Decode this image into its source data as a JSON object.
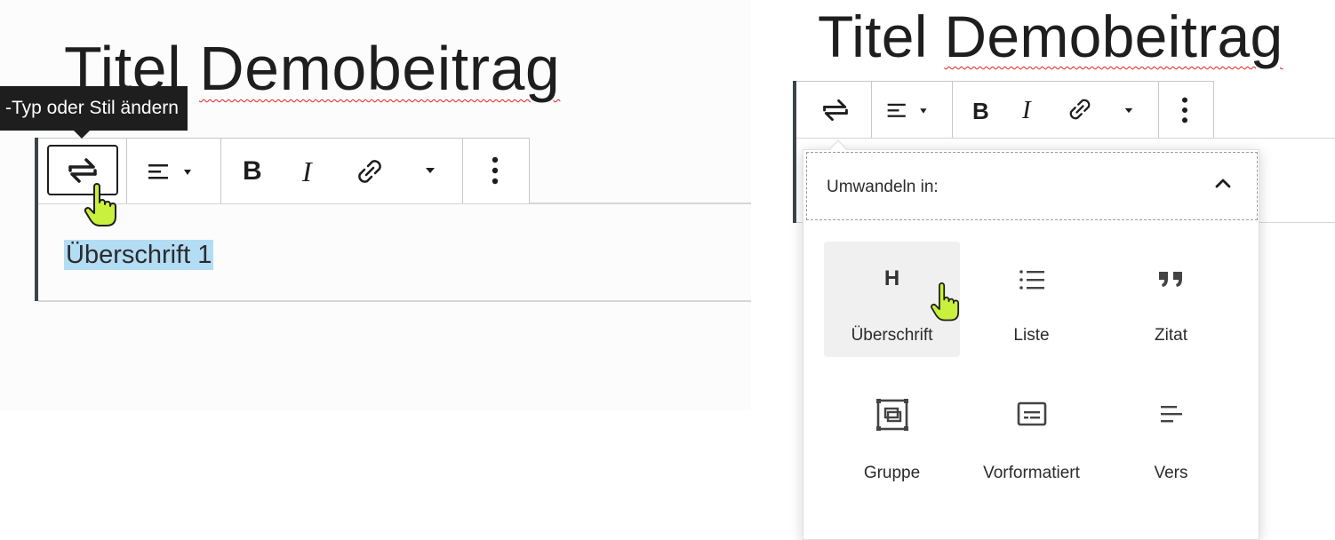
{
  "left": {
    "title_part1": "Titel",
    "title_part2": "Demobeitrag",
    "tooltip": "-Typ oder Stil ändern",
    "heading_text": "Überschrift 1"
  },
  "right": {
    "title_part1": "Titel",
    "title_part2": "Demobeitrag",
    "popover_title": "Umwandeln in:",
    "items": [
      {
        "label": "Überschrift",
        "icon": "heading-icon",
        "glyph": "H",
        "selected": true
      },
      {
        "label": "Liste",
        "icon": "list-icon"
      },
      {
        "label": "Zitat",
        "icon": "quote-icon"
      },
      {
        "label": "Gruppe",
        "icon": "group-icon"
      },
      {
        "label": "Vorformatiert",
        "icon": "preformatted-icon"
      },
      {
        "label": "Vers",
        "icon": "verse-icon"
      }
    ]
  },
  "toolbar": {
    "bold": "B",
    "italic": "I"
  },
  "colors": {
    "selection_highlight": "#b3dcf5",
    "cursor_hand": "#c8f03c",
    "spellcheck_underline": "#e02020",
    "selected_item_bg": "#f0f0f0"
  }
}
